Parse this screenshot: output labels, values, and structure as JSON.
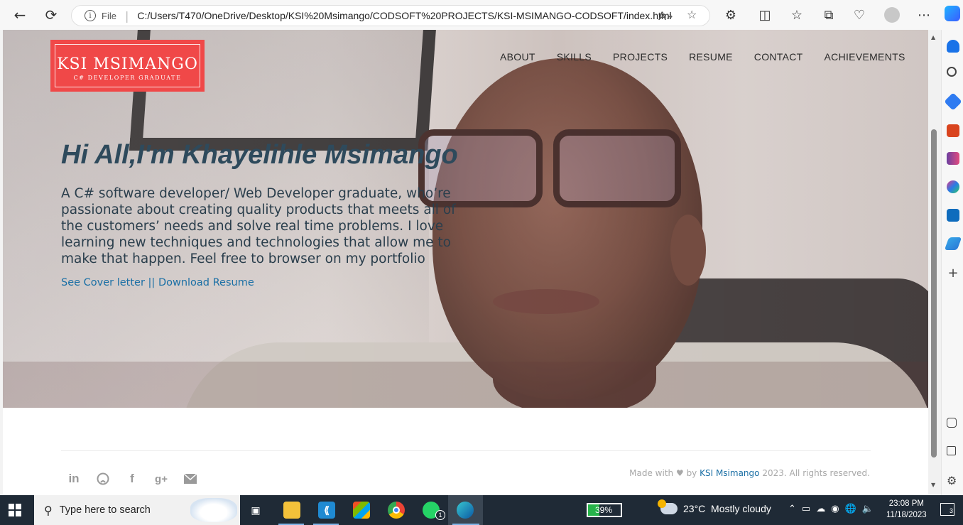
{
  "browser": {
    "file_label": "File",
    "url": "C:/Users/T470/OneDrive/Desktop/KSI%20Msimango/CODSOFT%20PROJECTS/KSI-MSIMANGO-CODSOFT/index.html",
    "read_aloud_icon": "A»"
  },
  "site": {
    "logo_name": "KSI MSIMANGO",
    "logo_tagline": "C# DEVELOPER GRADUATE",
    "nav": [
      "ABOUT",
      "SKILLS",
      "PROJECTS",
      "RESUME",
      "CONTACT",
      "ACHIEVEMENTS"
    ],
    "headline": "Hi All,I'm Khayelihle Msimango",
    "bio": "A C# software developer/ Web Developer graduate, who’re passionate about creating quality products that meets all of the customers’ needs and solve real time problems. I love learning new techniques and technologies that allow me to make that happen. Feel free to browser on my portfolio",
    "link_cover": "See Cover letter",
    "link_sep": " || ",
    "link_resume": "Download Resume",
    "footer": {
      "made_with": "Made with",
      "by": "by",
      "brand": "KSI Msimango",
      "rights": "2023. All rights reserved.",
      "socials": [
        "linkedin-icon",
        "github-icon",
        "facebook-icon",
        "google-plus-icon",
        "mail-icon"
      ]
    }
  },
  "taskbar": {
    "search_placeholder": "Type here to search",
    "battery": "39%",
    "weather": "23°C  Mostly cloudy",
    "time": "23:08 PM",
    "date": "11/18/2023",
    "notifications": "3",
    "whatsapp_badge": "1"
  },
  "colors": {
    "logo_bg": "#f04848",
    "link": "#1a6fa5",
    "headline": "#2e4a5c",
    "taskbar": "#1f2a36"
  }
}
